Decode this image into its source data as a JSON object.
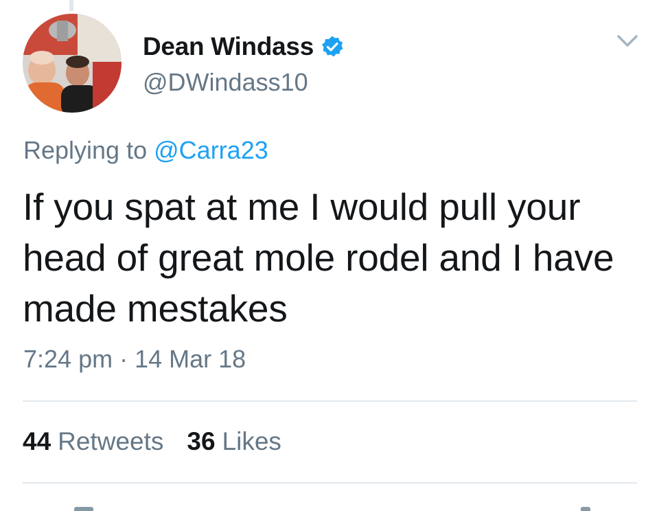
{
  "author": {
    "display_name": "Dean Windass",
    "handle": "@DWindass10",
    "verified_icon": "verified-badge-icon",
    "avatar": "profile-photo"
  },
  "reply": {
    "prefix": "Replying to",
    "mention": "@Carra23"
  },
  "tweet": {
    "text": "If you spat at me I would pull your head of great mole rodel and I have made mestakes",
    "timestamp": "7:24 pm · 14 Mar 18"
  },
  "stats": {
    "retweets_count": "44",
    "retweets_label": "Retweets",
    "likes_count": "36",
    "likes_label": "Likes"
  },
  "icons": {
    "more": "chevron-down-icon"
  },
  "colors": {
    "accent": "#1da1f2",
    "text_primary": "#14171a",
    "text_secondary": "#657786",
    "divider": "#e1e8ed"
  }
}
